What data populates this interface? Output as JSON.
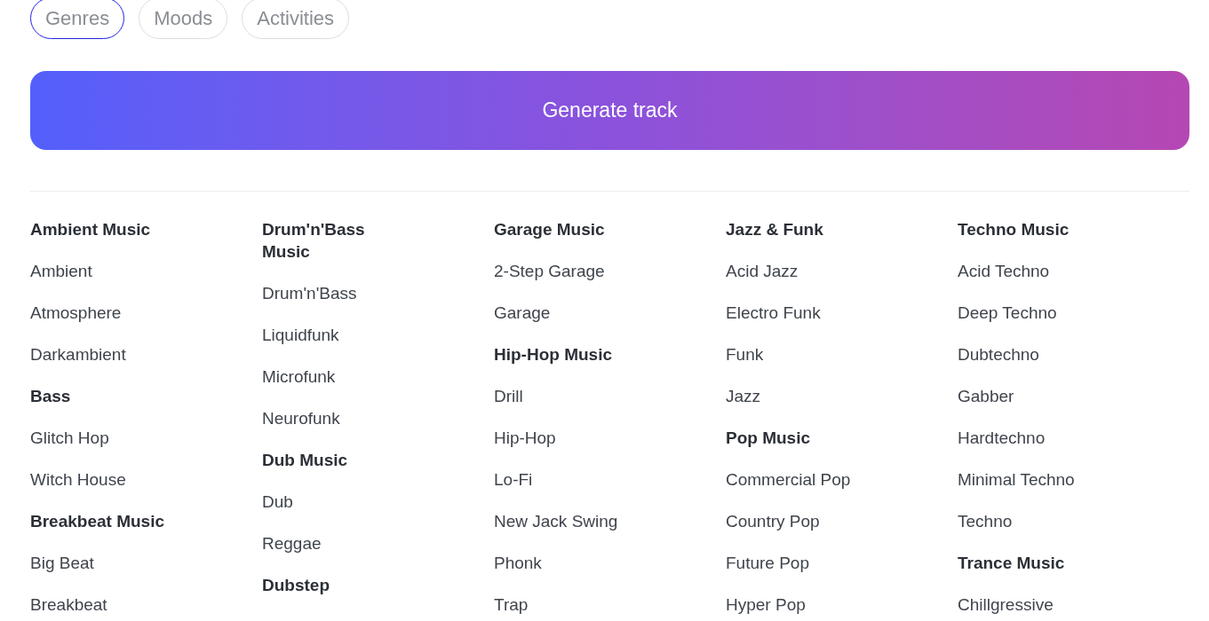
{
  "tabs": [
    {
      "label": "Genres",
      "selected": true
    },
    {
      "label": "Moods",
      "selected": false
    },
    {
      "label": "Activities",
      "selected": false
    }
  ],
  "generate_button": {
    "label": "Generate track"
  },
  "columns": [
    {
      "entries": [
        {
          "kind": "heading",
          "text": "Ambient Music"
        },
        {
          "kind": "item",
          "text": "Ambient"
        },
        {
          "kind": "item",
          "text": "Atmosphere"
        },
        {
          "kind": "item",
          "text": "Darkambient"
        },
        {
          "kind": "heading",
          "text": "Bass"
        },
        {
          "kind": "item",
          "text": "Glitch Hop"
        },
        {
          "kind": "item",
          "text": "Witch House"
        },
        {
          "kind": "heading",
          "text": "Breakbeat Music"
        },
        {
          "kind": "item",
          "text": "Big Beat"
        },
        {
          "kind": "item",
          "text": "Breakbeat"
        }
      ]
    },
    {
      "entries": [
        {
          "kind": "heading",
          "text": "Drum'n'Bass Music"
        },
        {
          "kind": "item",
          "text": "Drum'n'Bass"
        },
        {
          "kind": "item",
          "text": "Liquidfunk"
        },
        {
          "kind": "item",
          "text": "Microfunk"
        },
        {
          "kind": "item",
          "text": "Neurofunk"
        },
        {
          "kind": "heading",
          "text": "Dub Music"
        },
        {
          "kind": "item",
          "text": "Dub"
        },
        {
          "kind": "item",
          "text": "Reggae"
        },
        {
          "kind": "heading",
          "text": "Dubstep"
        }
      ]
    },
    {
      "entries": [
        {
          "kind": "heading",
          "text": "Garage Music"
        },
        {
          "kind": "item",
          "text": "2-Step Garage"
        },
        {
          "kind": "item",
          "text": "Garage"
        },
        {
          "kind": "heading",
          "text": "Hip-Hop Music"
        },
        {
          "kind": "item",
          "text": "Drill"
        },
        {
          "kind": "item",
          "text": "Hip-Hop"
        },
        {
          "kind": "item",
          "text": "Lo-Fi"
        },
        {
          "kind": "item",
          "text": "New Jack Swing"
        },
        {
          "kind": "item",
          "text": "Phonk"
        },
        {
          "kind": "item",
          "text": "Trap"
        }
      ]
    },
    {
      "entries": [
        {
          "kind": "heading",
          "text": "Jazz & Funk"
        },
        {
          "kind": "item",
          "text": "Acid Jazz"
        },
        {
          "kind": "item",
          "text": "Electro Funk"
        },
        {
          "kind": "item",
          "text": "Funk"
        },
        {
          "kind": "item",
          "text": "Jazz"
        },
        {
          "kind": "heading",
          "text": "Pop Music"
        },
        {
          "kind": "item",
          "text": "Commercial Pop"
        },
        {
          "kind": "item",
          "text": "Country Pop"
        },
        {
          "kind": "item",
          "text": "Future Pop"
        },
        {
          "kind": "item",
          "text": "Hyper Pop"
        }
      ]
    },
    {
      "entries": [
        {
          "kind": "heading",
          "text": "Techno Music"
        },
        {
          "kind": "item",
          "text": "Acid Techno"
        },
        {
          "kind": "item",
          "text": "Deep Techno"
        },
        {
          "kind": "item",
          "text": "Dubtechno"
        },
        {
          "kind": "item",
          "text": "Gabber"
        },
        {
          "kind": "item",
          "text": "Hardtechno"
        },
        {
          "kind": "item",
          "text": "Minimal Techno"
        },
        {
          "kind": "item",
          "text": "Techno"
        },
        {
          "kind": "heading",
          "text": "Trance Music"
        },
        {
          "kind": "item",
          "text": "Chillgressive"
        }
      ]
    }
  ]
}
